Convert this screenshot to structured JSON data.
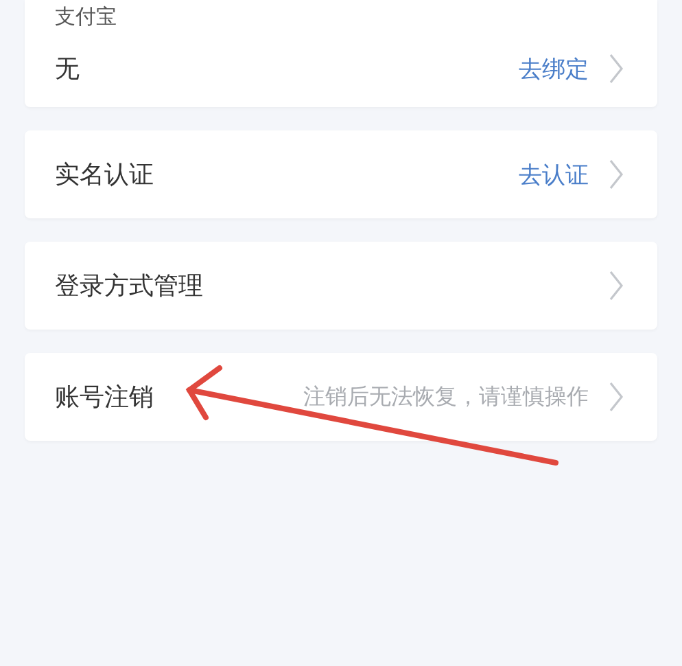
{
  "cards": [
    {
      "group_label": "支付宝",
      "rows": [
        {
          "kind": "action",
          "label": "无",
          "action": "去绑定"
        }
      ]
    },
    {
      "rows": [
        {
          "kind": "action",
          "label": "实名认证",
          "action": "去认证"
        }
      ]
    },
    {
      "rows": [
        {
          "kind": "plain",
          "label": "登录方式管理"
        }
      ]
    },
    {
      "rows": [
        {
          "kind": "hint",
          "label": "账号注销",
          "hint": "注销后无法恢复，请谨慎操作"
        }
      ]
    }
  ]
}
